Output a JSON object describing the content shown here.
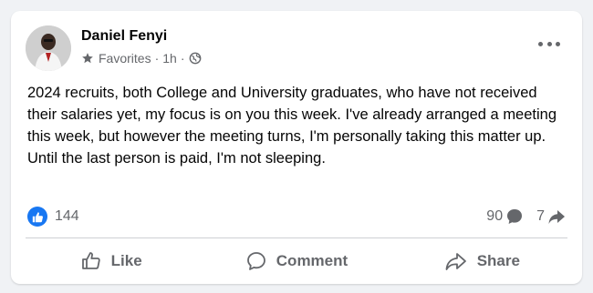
{
  "post": {
    "author": "Daniel Fenyi",
    "audience": "Favorites",
    "separator": "·",
    "time": "1h",
    "body": "2024 recruits, both College and University graduates, who have not received their salaries yet, my focus is on you this week. I've already arranged a meeting this week, but however the meeting turns, I'm personally taking this matter up. Until the last person is paid, I'm not sleeping."
  },
  "stats": {
    "reactions": "144",
    "comments": "90",
    "shares": "7"
  },
  "actions": {
    "like": "Like",
    "comment": "Comment",
    "share": "Share"
  },
  "icons": {
    "audience": "star-icon",
    "privacy": "globe-icon",
    "menu": "more-horizontal-icon",
    "reaction": "thumbs-up-icon",
    "comment_count": "comment-bubble-icon",
    "share_count": "share-arrow-icon"
  },
  "colors": {
    "brand": "#1877f2",
    "secondary_text": "#65676b",
    "background": "#f0f2f5",
    "card": "#ffffff"
  }
}
